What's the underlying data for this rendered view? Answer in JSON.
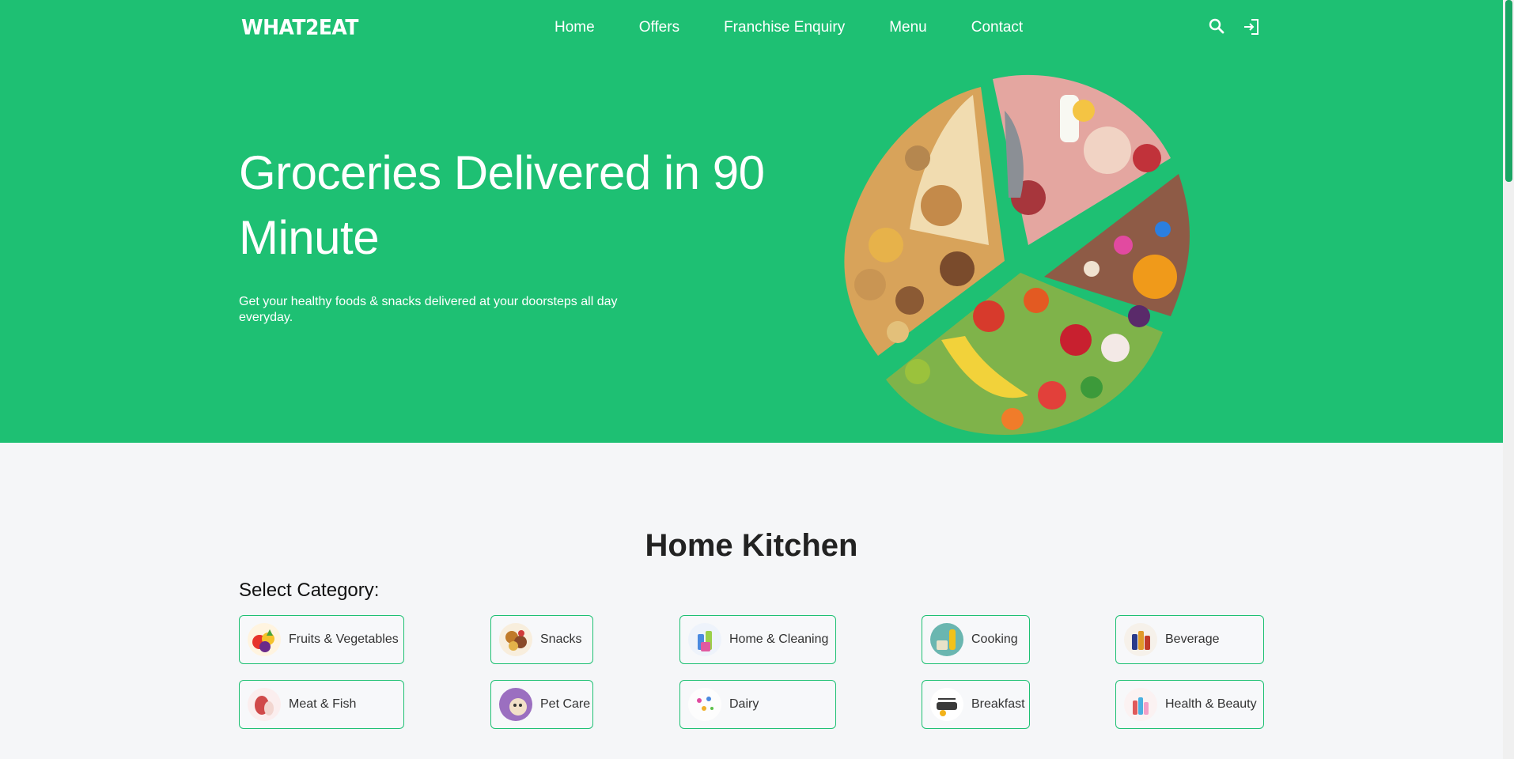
{
  "brand": {
    "logo": "WHAT2EAT"
  },
  "nav": {
    "links": [
      "Home",
      "Offers",
      "Franchise Enquiry",
      "Menu",
      "Contact"
    ],
    "icons": [
      "search-icon",
      "login-icon"
    ]
  },
  "hero": {
    "title": "Groceries Delivered in 90 Minute",
    "subtitle": "Get your healthy foods & snacks delivered at your doorsteps all day everyday."
  },
  "section": {
    "title": "Home Kitchen",
    "select_label": "Select Category:"
  },
  "categories": [
    {
      "label": "Fruits & Vegetables",
      "icon": "fruits-vegetables-icon"
    },
    {
      "label": "Snacks",
      "icon": "snacks-icon"
    },
    {
      "label": "Home & Cleaning",
      "icon": "home-cleaning-icon"
    },
    {
      "label": "Cooking",
      "icon": "cooking-icon"
    },
    {
      "label": "Beverage",
      "icon": "beverage-icon"
    },
    {
      "label": "Meat & Fish",
      "icon": "meat-fish-icon"
    },
    {
      "label": "Pet Care",
      "icon": "pet-care-icon"
    },
    {
      "label": "Dairy",
      "icon": "dairy-icon"
    },
    {
      "label": "Breakfast",
      "icon": "breakfast-icon"
    },
    {
      "label": "Health & Beauty",
      "icon": "health-beauty-icon"
    }
  ],
  "colors": {
    "brand_green": "#1ec073",
    "page_bg": "#f5f6f8",
    "border": "#1ec073"
  }
}
